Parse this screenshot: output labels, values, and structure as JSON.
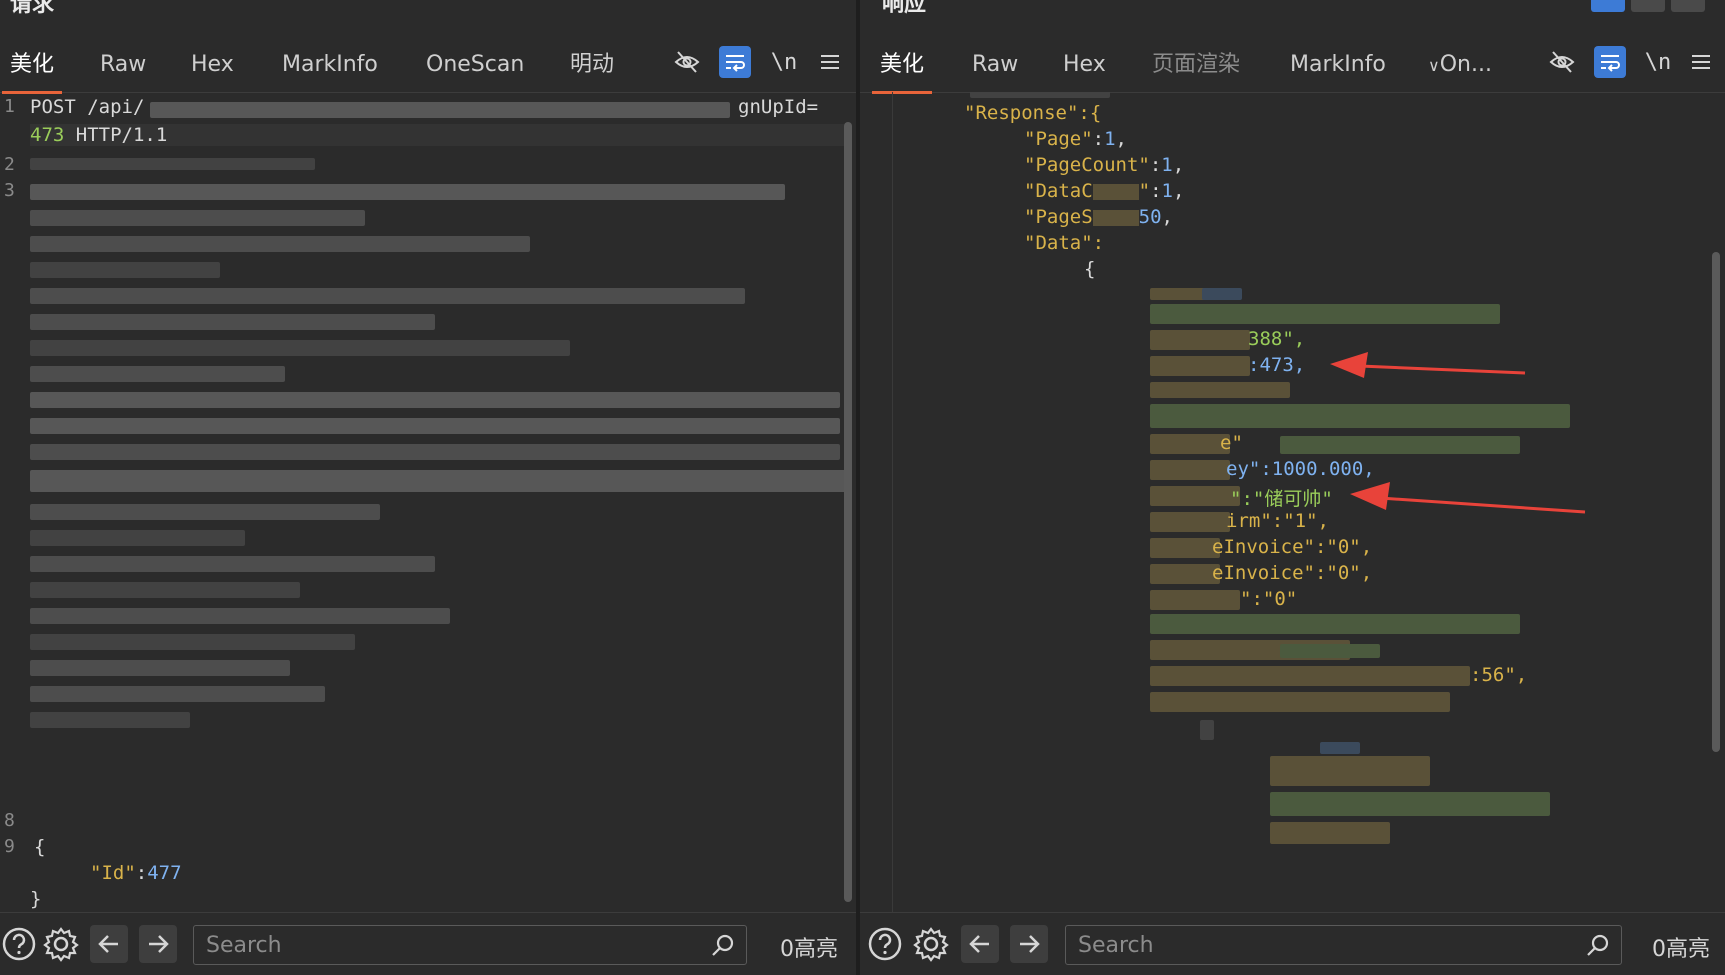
{
  "left": {
    "title": "请求",
    "tabs": [
      "美化",
      "Raw",
      "Hex",
      "MarkInfo",
      "OneScan",
      "明动"
    ],
    "active_tab": "美化",
    "lines": {
      "l1_num": "1",
      "l1_text": "POST /api/",
      "l1_tail": "gnUpId=",
      "l1b_text": "473",
      "l1b_tail": " HTTP/1.1",
      "l2_num": "2",
      "l3_num": "3",
      "l8_num": "8",
      "l9_num": "9",
      "brace_open": "{",
      "id_key": "\"Id\"",
      "id_colon": ":",
      "id_val": "477",
      "brace_close": "}"
    },
    "search_placeholder": "Search",
    "highlights": "0高亮"
  },
  "right": {
    "title": "响应",
    "tabs": [
      "美化",
      "Raw",
      "Hex",
      "页面渲染",
      "MarkInfo",
      "On..."
    ],
    "active_tab": "美化",
    "lines": {
      "response_key": "\"Response\":{",
      "page_key": "\"Page\"",
      "page_val": "1",
      "pagecount_key": "\"PageCount\"",
      "pagecount_val": "1",
      "datacount_key": "\"DataC",
      "datacount_val": "1",
      "pagesize_key": "\"PageS",
      "pagesize_val": "50",
      "data_key": "\"Data\":",
      "brace": "{",
      "v_388": "388\",",
      "v_473": ":473,",
      "v_money": "ey\":1000.000,",
      "v_ze": "e\"",
      "v_name": "\":\"储可帅\"",
      "v_irm": "irm\":\"1\",",
      "v_inv1": "eInvoice\":\"0\",",
      "v_inv2": "eInvoice\":\"0\",",
      "v_zero": "\":\"0\"",
      "v_time": ":56\","
    },
    "search_placeholder": "Search",
    "highlights": "0高亮"
  },
  "colors": {
    "accent_tab": "#e8643a",
    "toggle_on": "#3d7bd6",
    "arrow": "#e8433a"
  }
}
